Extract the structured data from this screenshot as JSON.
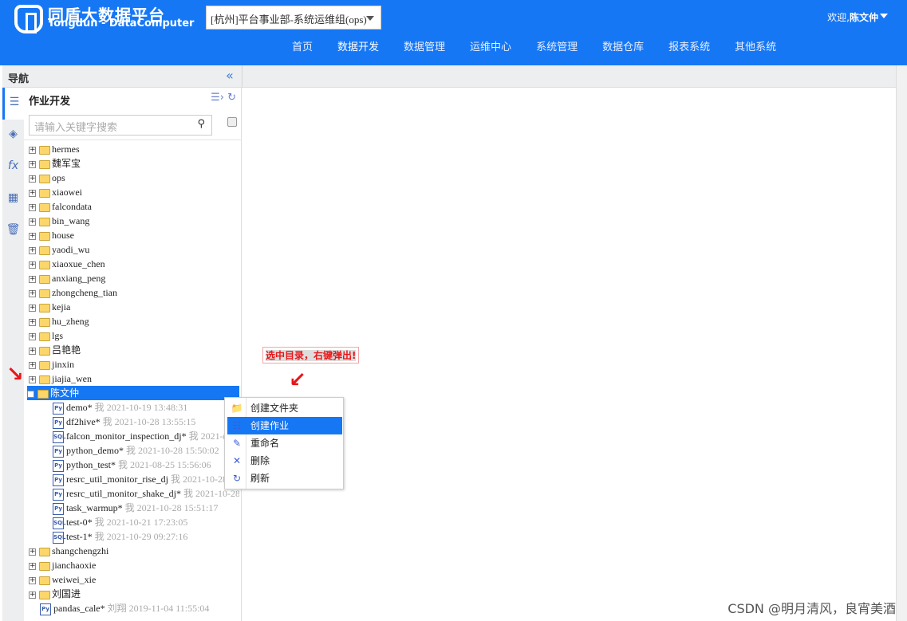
{
  "header": {
    "brand_cn": "同盾大数据平台",
    "brand_en": "Tongdun - DataComputer",
    "org_select": "[杭州]平台事业部-系统运维组(ops)",
    "welcome": "欢迎,",
    "user": "陈文仲",
    "nav": [
      "首页",
      "数据开发",
      "数据管理",
      "运维中心",
      "系统管理",
      "数据仓库",
      "报表系统",
      "其他系统"
    ],
    "active_nav": "数据开发"
  },
  "sidebar": {
    "title": "导航",
    "panel_title": "作业开发",
    "search_placeholder": "请输入关键字搜索"
  },
  "tree": {
    "folders_top": [
      "hermes",
      "魏军宝",
      "ops",
      "xiaowei",
      "falcondata",
      "bin_wang",
      "house",
      "yaodi_wu",
      "xiaoxue_chen",
      "anxiang_peng",
      "zhongcheng_tian",
      "kejia",
      "hu_zheng",
      "lgs",
      "吕艳艳",
      "jinxin",
      "jiajia_wen"
    ],
    "selected": "陈文仲",
    "children": [
      {
        "type": "Py",
        "name": "demo*",
        "owner": "我",
        "time": "2021-10-19 13:48:31"
      },
      {
        "type": "Py",
        "name": "df2hive*",
        "owner": "我",
        "time": "2021-10-28 13:55:15"
      },
      {
        "type": "SQL",
        "name": "falcon_monitor_inspection_dj*",
        "owner": "我",
        "time": "2021-("
      },
      {
        "type": "Py",
        "name": "python_demo*",
        "owner": "我",
        "time": "2021-10-28 15:50:02"
      },
      {
        "type": "Py",
        "name": "python_test*",
        "owner": "我",
        "time": "2021-08-25 15:56:06"
      },
      {
        "type": "Py",
        "name": "resrc_util_monitor_rise_dj",
        "owner": "我",
        "time": "2021-10-28"
      },
      {
        "type": "Py",
        "name": "resrc_util_monitor_shake_dj*",
        "owner": "我",
        "time": "2021-10-28"
      },
      {
        "type": "Py",
        "name": "task_warmup*",
        "owner": "我",
        "time": "2021-10-28 15:51:17"
      },
      {
        "type": "SQL",
        "name": "test-0*",
        "owner": "我",
        "time": "2021-10-21 17:23:05"
      },
      {
        "type": "SQL",
        "name": "test-1*",
        "owner": "我",
        "time": "2021-10-29 09:27:16"
      }
    ],
    "folders_bottom": [
      "shangchengzhi",
      "jianchaoxie",
      "weiwei_xie",
      "刘国进"
    ],
    "last_file": {
      "type": "Py",
      "name": "pandas_cale*",
      "owner": "刘翔",
      "time": "2019-11-04 11:55:04"
    }
  },
  "context_menu": [
    {
      "label": "创建文件夹",
      "icon": "folder-icon"
    },
    {
      "label": "创建作业",
      "icon": "job-icon"
    },
    {
      "label": "重命名",
      "icon": "edit-icon"
    },
    {
      "label": "删除",
      "icon": "delete-icon"
    },
    {
      "label": "刷新",
      "icon": "refresh-icon"
    }
  ],
  "annotation": "选中目录，右键弹出!",
  "watermark": "CSDN @明月清风，良宵美酒",
  "colors": {
    "brand": "#1677f5",
    "annotation": "#e8161a"
  }
}
